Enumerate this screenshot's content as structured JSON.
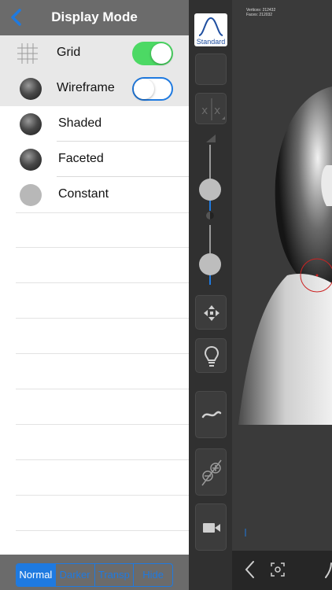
{
  "header": {
    "title": "Display Mode"
  },
  "toggles": [
    {
      "label": "Grid",
      "on": true
    },
    {
      "label": "Wireframe",
      "on": false
    }
  ],
  "modes": [
    {
      "label": "Shaded",
      "icon": "shaded-sphere-icon"
    },
    {
      "label": "Faceted",
      "icon": "faceted-sphere-icon"
    },
    {
      "label": "Constant",
      "icon": "constant-sphere-icon"
    }
  ],
  "segments": [
    "Normal",
    "Darker",
    "Transp",
    "Hide"
  ],
  "toolbar": {
    "standard_label": "Standard"
  },
  "viewport": {
    "vertices_label": "Vertices: 212432",
    "faces_label": "Faces:     212032"
  },
  "colors": {
    "accent": "#1f7ae0",
    "toggle_on": "#4cd964",
    "header_bg": "#6b6b6b"
  }
}
